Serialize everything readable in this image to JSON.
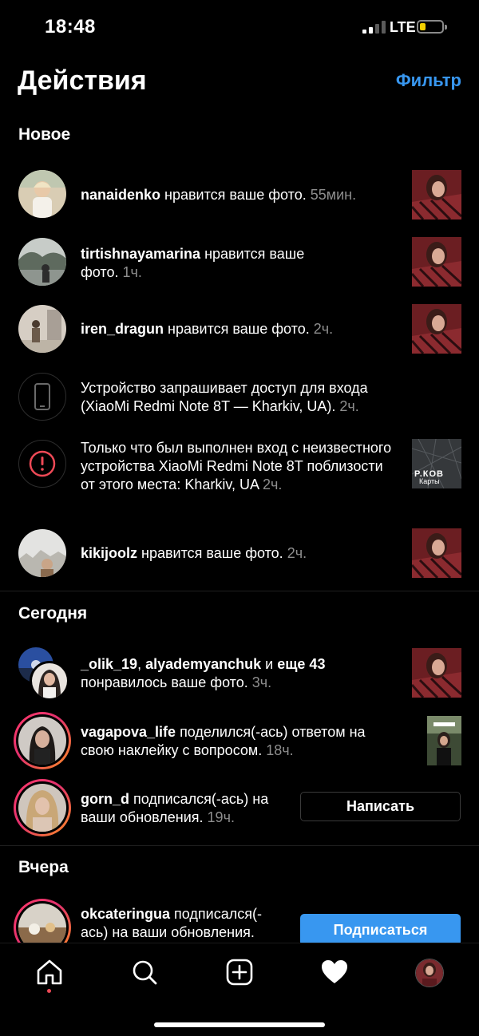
{
  "status": {
    "time": "18:48",
    "network": "LTE",
    "battery_level": 0.25
  },
  "header": {
    "title": "Действия",
    "filter_label": "Фильтр"
  },
  "sections": {
    "new": "Новое",
    "today": "Сегодня",
    "yesterday": "Вчера"
  },
  "new_items": [
    {
      "user": "nanaidenko",
      "text": " нравится ваше фото. ",
      "time": "55мин."
    },
    {
      "user": "tirtishnayamarina",
      "text": " нравится ваше фото. ",
      "time": "1ч."
    },
    {
      "user": "iren_dragun",
      "text": " нравится ваше фото. ",
      "time": "2ч."
    },
    {
      "text": "Устройство запрашивает доступ для входа (XiaoMi Redmi Note 8T — Kharkiv, UA). ",
      "time": "2ч."
    },
    {
      "text": "Только что был выполнен вход с неизвестного устройства XiaoMi Redmi Note 8T поблизости от этого места: Kharkiv, UA ",
      "time": "2ч.",
      "map_label": "Р.КОВ",
      "map_sublabel": "Карты"
    },
    {
      "user": "kikijoolz",
      "text": " нравится ваше фото. ",
      "time": "2ч."
    }
  ],
  "today_items": [
    {
      "user": "_olik_19",
      "sep": ", ",
      "user2": "alyademyanchuk",
      "and": " и ",
      "more": "еще 43",
      "text": " понравилось ваше фото. ",
      "time": "3ч."
    },
    {
      "user": "vagapova_life",
      "text": " поделился(-ась) ответом на свою наклейку с вопросом. ",
      "time": "18ч."
    },
    {
      "user": "gorn_d",
      "text": " подписался(-ась) на ваши обновления. ",
      "time": "19ч.",
      "button": "Написать"
    }
  ],
  "yesterday_items": [
    {
      "user": "okcateringua",
      "text": " подписался(-ась) на ваши обновления. ",
      "button": "Подписаться"
    }
  ],
  "tabbar": {
    "icons": [
      "home-icon",
      "search-icon",
      "add-post-icon",
      "activity-heart-icon",
      "profile-avatar"
    ]
  },
  "colors": {
    "accent": "#3897f0",
    "timestamp": "#8e8e8e",
    "background": "#000000"
  }
}
